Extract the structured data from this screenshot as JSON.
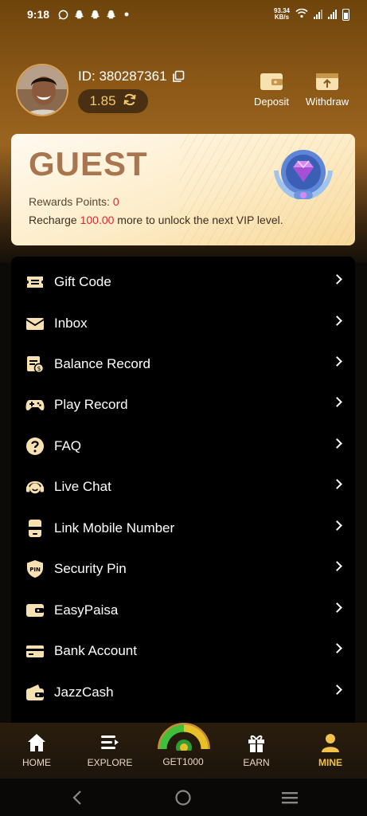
{
  "status_bar": {
    "time": "9:18",
    "net_speed_value": "93.34",
    "net_speed_unit": "KB/s"
  },
  "profile": {
    "id_text": "ID: 380287361",
    "balance": "1.85"
  },
  "actions": {
    "deposit": "Deposit",
    "withdraw": "Withdraw"
  },
  "vip": {
    "level": "GUEST",
    "points_label": "Rewards Points: ",
    "points_value": "0",
    "recharge_prefix": "Recharge ",
    "recharge_amount": "100.00",
    "recharge_suffix": " more to unlock the next VIP level."
  },
  "menu": {
    "items": [
      {
        "label": "Gift Code",
        "icon": "ticket-icon"
      },
      {
        "label": "Inbox",
        "icon": "mail-icon"
      },
      {
        "label": "Balance Record",
        "icon": "balance-record-icon"
      },
      {
        "label": "Play Record",
        "icon": "gamepad-icon"
      },
      {
        "label": "FAQ",
        "icon": "question-icon"
      },
      {
        "label": "Live Chat",
        "icon": "headset-icon"
      },
      {
        "label": "Link Mobile Number",
        "icon": "phone-icon"
      },
      {
        "label": "Security Pin",
        "icon": "shield-pin-icon"
      },
      {
        "label": "EasyPaisa",
        "icon": "wallet-icon"
      },
      {
        "label": "Bank Account",
        "icon": "card-icon"
      },
      {
        "label": "JazzCash",
        "icon": "wallet-cash-icon"
      }
    ]
  },
  "nav": {
    "home": "HOME",
    "explore": "EXPLORE",
    "get": "GET1000",
    "earn": "EARN",
    "mine": "MINE"
  },
  "colors": {
    "accent_gold": "#f2c24a",
    "highlight_red": "#e0262e",
    "vip_text": "#a8754f"
  }
}
